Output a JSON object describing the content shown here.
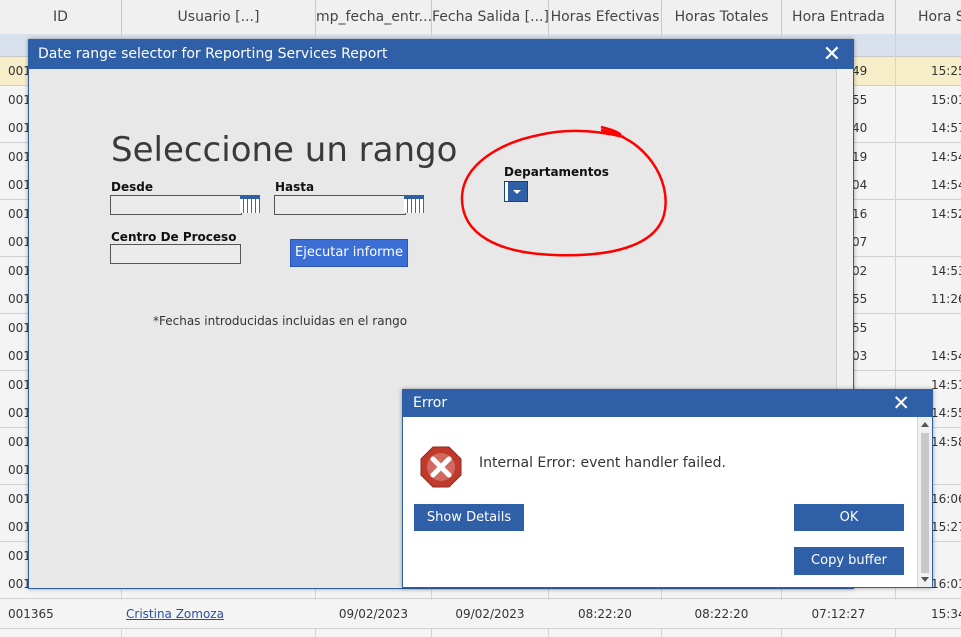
{
  "grid": {
    "columns": [
      "ID",
      "Usuario [...]",
      "mp_fecha_entr...",
      "Fecha Salida [...]",
      "Horas Efectivas",
      "Horas Totales",
      "Hora Entrada",
      "Hora S"
    ],
    "rows": [
      {
        "id": "001",
        "entrada": "49",
        "salida": "15:25",
        "highlight": true
      },
      {
        "id": "001",
        "entrada": "55",
        "salida": "15:01"
      },
      {
        "id": "001",
        "entrada": "40",
        "salida": "14:57"
      },
      {
        "id": "001",
        "entrada": "19",
        "salida": "14:54"
      },
      {
        "id": "001",
        "entrada": "04",
        "salida": "14:54"
      },
      {
        "id": "001",
        "entrada": "16",
        "salida": "14:52"
      },
      {
        "id": "001",
        "entrada": "07",
        "salida": ""
      },
      {
        "id": "001",
        "entrada": "02",
        "salida": "14:53"
      },
      {
        "id": "001",
        "entrada": "55",
        "salida": "11:26"
      },
      {
        "id": "001",
        "entrada": "55",
        "salida": ""
      },
      {
        "id": "001",
        "entrada": "03",
        "salida": "14:54"
      },
      {
        "id": "001",
        "entrada": "",
        "salida": "14:51"
      },
      {
        "id": "001",
        "entrada": "",
        "salida": "14:55"
      },
      {
        "id": "001",
        "entrada": "",
        "salida": "14:58"
      },
      {
        "id": "001",
        "entrada": "",
        "salida": ""
      },
      {
        "id": "001",
        "entrada": "",
        "salida": "16:06"
      },
      {
        "id": "001",
        "entrada": "",
        "salida": "15:27"
      },
      {
        "id": "001",
        "entrada": "",
        "salida": ""
      },
      {
        "id": "001",
        "entrada": "",
        "salida": "16:01"
      }
    ],
    "last_row": {
      "id": "001365",
      "usuario": "Cristina Zomoza",
      "fecha_entrada": "09/02/2023",
      "fecha_salida": "09/02/2023",
      "horas_efectivas": "08:22:20",
      "horas_totales": "08:22:20",
      "hora_entrada": "07:12:27",
      "hora_salida": "15:34"
    }
  },
  "dialog": {
    "title": "Date range selector for Reporting Services Report",
    "heading": "Seleccione un rango",
    "desde_label": "Desde",
    "hasta_label": "Hasta",
    "centro_label": "Centro De Proceso",
    "run_button": "Ejecutar informe",
    "departamentos_label": "Departamentos",
    "note": "*Fechas introducidas incluidas en el rango",
    "annotation_color": "#ff0000"
  },
  "error": {
    "title": "Error",
    "message": "Internal Error: event handler failed.",
    "show_details": "Show Details",
    "ok": "OK",
    "copy_buffer": "Copy buffer"
  },
  "colors": {
    "accent": "#2f5fa7",
    "button": "#3c6fd6",
    "error_icon": "#c0392b"
  }
}
